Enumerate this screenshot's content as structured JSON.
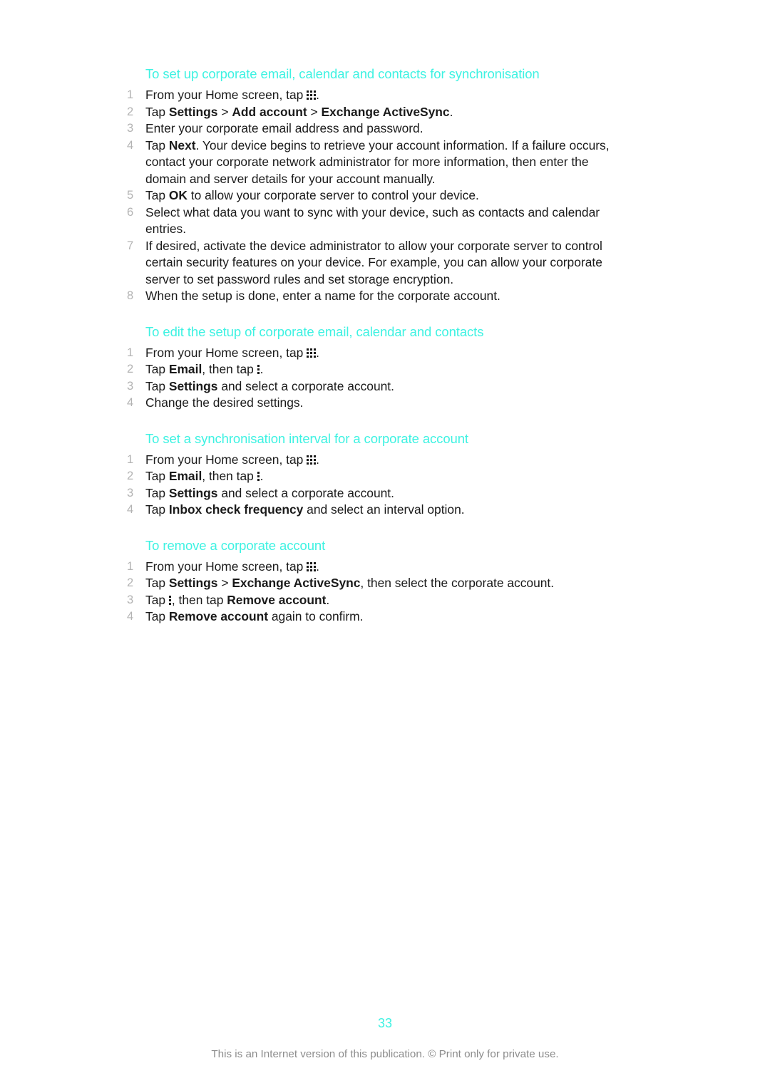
{
  "page": {
    "number": "33",
    "footer_note": "This is an Internet version of this publication. © Print only for private use.",
    "heading_color": "#3ef2e2",
    "body_color": "#1a1a1a",
    "number_color": "#b3b3b3",
    "footer_color": "#8c8c8c"
  },
  "icons": {
    "app_grid": "app-grid-icon",
    "overflow_menu": "overflow-menu-icon"
  },
  "sections": [
    {
      "heading": "To set up corporate email, calendar and contacts for synchronisation",
      "steps": [
        {
          "parts": [
            {
              "t": "From your Home screen, tap "
            },
            {
              "icon": "app-grid"
            },
            {
              "t": "."
            }
          ]
        },
        {
          "parts": [
            {
              "t": "Tap "
            },
            {
              "t": "Settings",
              "bold": true
            },
            {
              "t": " > "
            },
            {
              "t": "Add account",
              "bold": true
            },
            {
              "t": " > "
            },
            {
              "t": "Exchange ActiveSync",
              "bold": true
            },
            {
              "t": "."
            }
          ]
        },
        {
          "parts": [
            {
              "t": "Enter your corporate email address and password."
            }
          ]
        },
        {
          "parts": [
            {
              "t": "Tap "
            },
            {
              "t": "Next",
              "bold": true
            },
            {
              "t": ". Your device begins to retrieve your account information. If a failure occurs, contact your corporate network administrator for more information, then enter the domain and server details for your account manually."
            }
          ]
        },
        {
          "parts": [
            {
              "t": "Tap "
            },
            {
              "t": "OK",
              "bold": true
            },
            {
              "t": " to allow your corporate server to control your device."
            }
          ]
        },
        {
          "parts": [
            {
              "t": "Select what data you want to sync with your device, such as contacts and calendar entries."
            }
          ]
        },
        {
          "parts": [
            {
              "t": "If desired, activate the device administrator to allow your corporate server to control certain security features on your device. For example, you can allow your corporate server to set password rules and set storage encryption."
            }
          ]
        },
        {
          "parts": [
            {
              "t": "When the setup is done, enter a name for the corporate account."
            }
          ]
        }
      ]
    },
    {
      "heading": "To edit the setup of corporate email, calendar and contacts",
      "steps": [
        {
          "parts": [
            {
              "t": "From your Home screen, tap "
            },
            {
              "icon": "app-grid"
            },
            {
              "t": "."
            }
          ]
        },
        {
          "parts": [
            {
              "t": "Tap "
            },
            {
              "t": "Email",
              "bold": true
            },
            {
              "t": ", then tap "
            },
            {
              "icon": "overflow"
            },
            {
              "t": "."
            }
          ]
        },
        {
          "parts": [
            {
              "t": "Tap "
            },
            {
              "t": "Settings",
              "bold": true
            },
            {
              "t": " and select a corporate account."
            }
          ]
        },
        {
          "parts": [
            {
              "t": "Change the desired settings."
            }
          ]
        }
      ]
    },
    {
      "heading": "To set a synchronisation interval for a corporate account",
      "steps": [
        {
          "parts": [
            {
              "t": "From your Home screen, tap "
            },
            {
              "icon": "app-grid"
            },
            {
              "t": "."
            }
          ]
        },
        {
          "parts": [
            {
              "t": "Tap "
            },
            {
              "t": "Email",
              "bold": true
            },
            {
              "t": ", then tap "
            },
            {
              "icon": "overflow"
            },
            {
              "t": "."
            }
          ]
        },
        {
          "parts": [
            {
              "t": "Tap "
            },
            {
              "t": "Settings",
              "bold": true
            },
            {
              "t": " and select a corporate account."
            }
          ]
        },
        {
          "parts": [
            {
              "t": "Tap "
            },
            {
              "t": "Inbox check frequency",
              "bold": true
            },
            {
              "t": " and select an interval option."
            }
          ]
        }
      ]
    },
    {
      "heading": "To remove a corporate account",
      "steps": [
        {
          "parts": [
            {
              "t": "From your Home screen, tap "
            },
            {
              "icon": "app-grid"
            },
            {
              "t": "."
            }
          ]
        },
        {
          "parts": [
            {
              "t": "Tap "
            },
            {
              "t": "Settings",
              "bold": true
            },
            {
              "t": " > "
            },
            {
              "t": "Exchange ActiveSync",
              "bold": true
            },
            {
              "t": ", then select the corporate account."
            }
          ]
        },
        {
          "parts": [
            {
              "t": "Tap "
            },
            {
              "icon": "overflow"
            },
            {
              "t": ", then tap "
            },
            {
              "t": "Remove account",
              "bold": true
            },
            {
              "t": "."
            }
          ]
        },
        {
          "parts": [
            {
              "t": "Tap "
            },
            {
              "t": "Remove account",
              "bold": true
            },
            {
              "t": " again to confirm."
            }
          ]
        }
      ]
    }
  ]
}
